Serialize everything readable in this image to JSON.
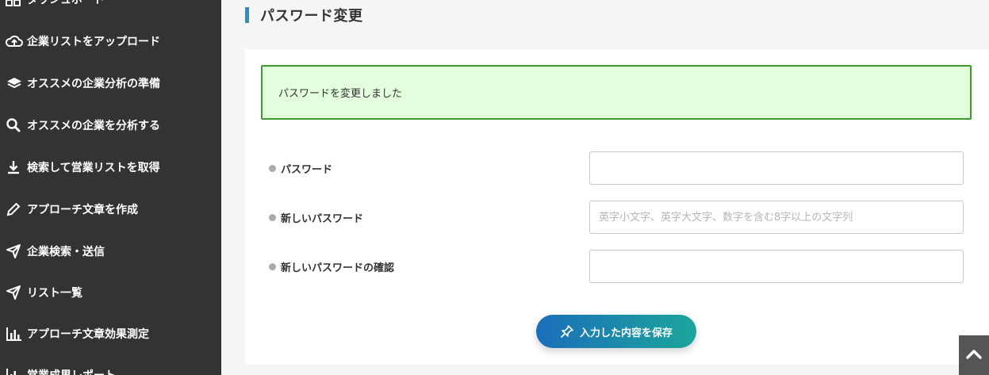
{
  "sidebar": {
    "items": [
      {
        "label": "ダッシュボード",
        "icon": "grid-icon"
      },
      {
        "label": "企業リストをアップロード",
        "icon": "cloud-upload-icon"
      },
      {
        "label": "オススメの企業分析の準備",
        "icon": "layers-icon"
      },
      {
        "label": "オススメの企業を分析する",
        "icon": "search-icon"
      },
      {
        "label": "検索して営業リストを取得",
        "icon": "download-icon"
      },
      {
        "label": "アプローチ文章を作成",
        "icon": "pencil-icon"
      },
      {
        "label": "企業検索・送信",
        "icon": "send-icon"
      },
      {
        "label": "リスト一覧",
        "icon": "send-icon"
      },
      {
        "label": "アプローチ文章効果測定",
        "icon": "bar-chart-icon"
      },
      {
        "label": "営業成果レポート",
        "icon": "bar-chart-icon"
      }
    ]
  },
  "page": {
    "title": "パスワード変更"
  },
  "alert": {
    "message": "パスワードを変更しました"
  },
  "form": {
    "password_label": "パスワード",
    "password_value": "",
    "new_password_label": "新しいパスワード",
    "new_password_placeholder": "英字小文字、英字大文字、数字を含む8字以上の文字列",
    "confirm_password_label": "新しいパスワードの確認",
    "confirm_password_value": "",
    "save_label": "入力した内容を保存"
  },
  "colors": {
    "sidebar_bg": "#333333",
    "accent": "#2a8fc4",
    "alert_bg": "#e3fedc",
    "alert_border": "#3e9b2c",
    "button_gradient_start": "#1b6fba",
    "button_gradient_end": "#1ba59a"
  }
}
